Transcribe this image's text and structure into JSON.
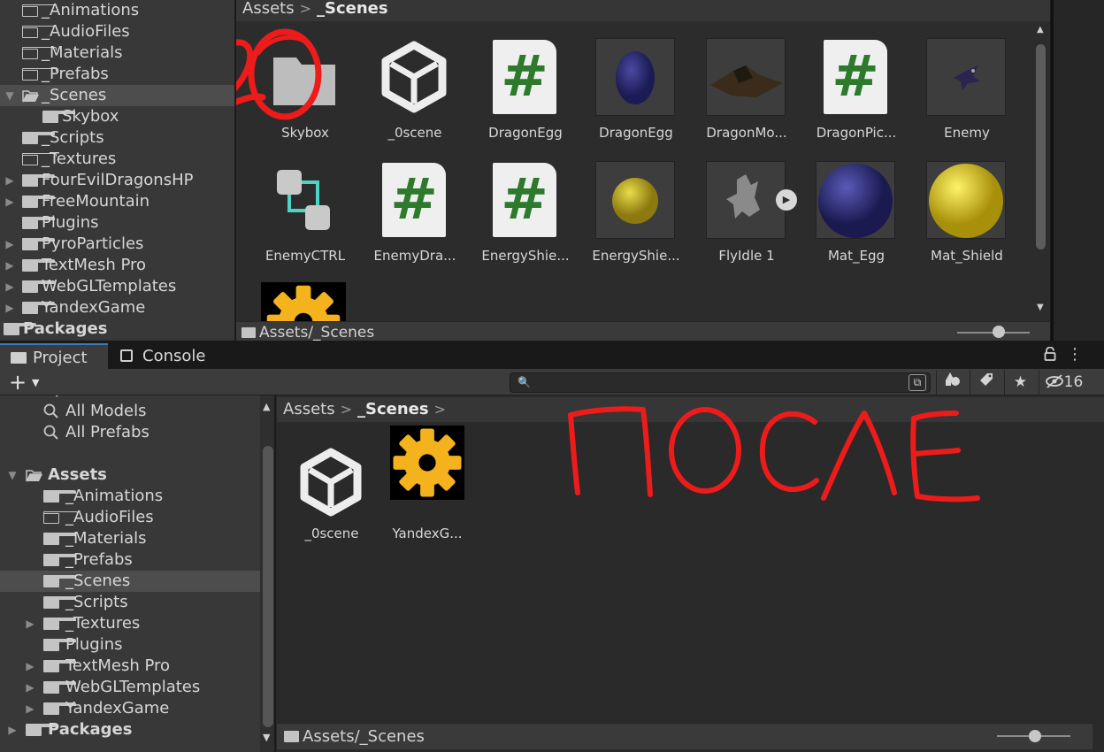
{
  "top_panel": {
    "tree": [
      {
        "label": "_Animations",
        "icon": "folder-empty-icon"
      },
      {
        "label": "_AudioFiles",
        "icon": "folder-empty-icon"
      },
      {
        "label": "_Materials",
        "icon": "folder-empty-icon"
      },
      {
        "label": "_Prefabs",
        "icon": "folder-empty-icon"
      },
      {
        "label": "_Scenes",
        "icon": "folder-open-icon",
        "selected": true,
        "expanded": true
      },
      {
        "label": "Skybox",
        "icon": "folder-solid-icon",
        "child": true
      },
      {
        "label": "_Scripts",
        "icon": "folder-solid-icon"
      },
      {
        "label": "_Textures",
        "icon": "folder-empty-icon"
      },
      {
        "label": "FourEvilDragonsHP",
        "icon": "folder-solid-icon",
        "collapsed": true
      },
      {
        "label": "FreeMountain",
        "icon": "folder-solid-icon",
        "collapsed": true
      },
      {
        "label": "Plugins",
        "icon": "folder-solid-icon"
      },
      {
        "label": "PyroParticles",
        "icon": "folder-solid-icon",
        "collapsed": true
      },
      {
        "label": "TextMesh Pro",
        "icon": "folder-solid-icon",
        "collapsed": true
      },
      {
        "label": "WebGLTemplates",
        "icon": "folder-solid-icon",
        "collapsed": true
      },
      {
        "label": "YandexGame",
        "icon": "folder-solid-icon",
        "collapsed": true
      },
      {
        "label": "Packages",
        "icon": "folder-solid-icon",
        "bold": true
      }
    ],
    "breadcrumb": {
      "root": "Assets",
      "current": "_Scenes"
    },
    "assets_row1": [
      "Skybox",
      "_0scene",
      "DragonEgg",
      "DragonEgg",
      "DragonMo...",
      "DragonPic...",
      "Enemy"
    ],
    "assets_row2": [
      "EnemyCTRL",
      "EnemyDra...",
      "EnergyShie...",
      "EnergyShie...",
      "FlyIdle 1",
      "Mat_Egg",
      "Mat_Shield"
    ],
    "status_path": "Assets/_Scenes",
    "annotation": "ДО"
  },
  "bottom_panel": {
    "tabs": [
      {
        "label": "Project",
        "icon": "folder-icon",
        "active": true
      },
      {
        "label": "Console",
        "icon": "console-icon",
        "active": false
      }
    ],
    "toolbar": {
      "add_label": "+",
      "search_placeholder": "",
      "hidden_count": "16"
    },
    "tree": [
      {
        "label": "All Materials",
        "icon": "search-icon",
        "partial": true
      },
      {
        "label": "All Models",
        "icon": "search-icon"
      },
      {
        "label": "All Prefabs",
        "icon": "search-icon"
      },
      {
        "label": "",
        "spacer": true
      },
      {
        "label": "Assets",
        "icon": "folder-open-icon",
        "bold": true,
        "expanded": true
      },
      {
        "label": "_Animations",
        "icon": "folder-solid-icon"
      },
      {
        "label": "_AudioFiles",
        "icon": "folder-empty-icon"
      },
      {
        "label": "_Materials",
        "icon": "folder-solid-icon"
      },
      {
        "label": "_Prefabs",
        "icon": "folder-solid-icon"
      },
      {
        "label": "_Scenes",
        "icon": "folder-solid-icon",
        "selected": true
      },
      {
        "label": "_Scripts",
        "icon": "folder-solid-icon"
      },
      {
        "label": "_Textures",
        "icon": "folder-solid-icon",
        "collapsed": true
      },
      {
        "label": "Plugins",
        "icon": "folder-solid-icon"
      },
      {
        "label": "TextMesh Pro",
        "icon": "folder-solid-icon",
        "collapsed": true
      },
      {
        "label": "WebGLTemplates",
        "icon": "folder-solid-icon",
        "collapsed": true
      },
      {
        "label": "YandexGame",
        "icon": "folder-solid-icon",
        "collapsed": true
      },
      {
        "label": "Packages",
        "icon": "folder-solid-icon",
        "bold": true,
        "collapsed": true
      }
    ],
    "breadcrumb": {
      "root": "Assets",
      "current": "_Scenes"
    },
    "assets": [
      "_0scene",
      "YandexG..."
    ],
    "status_path": "Assets/_Scenes",
    "annotation": "ПОСЛЕ"
  },
  "colors": {
    "annotation_red": "#ee1b1b",
    "csharp_green": "#2d7a2d",
    "selection": "#4d4d4d",
    "tab_accent": "#3a79bb"
  }
}
